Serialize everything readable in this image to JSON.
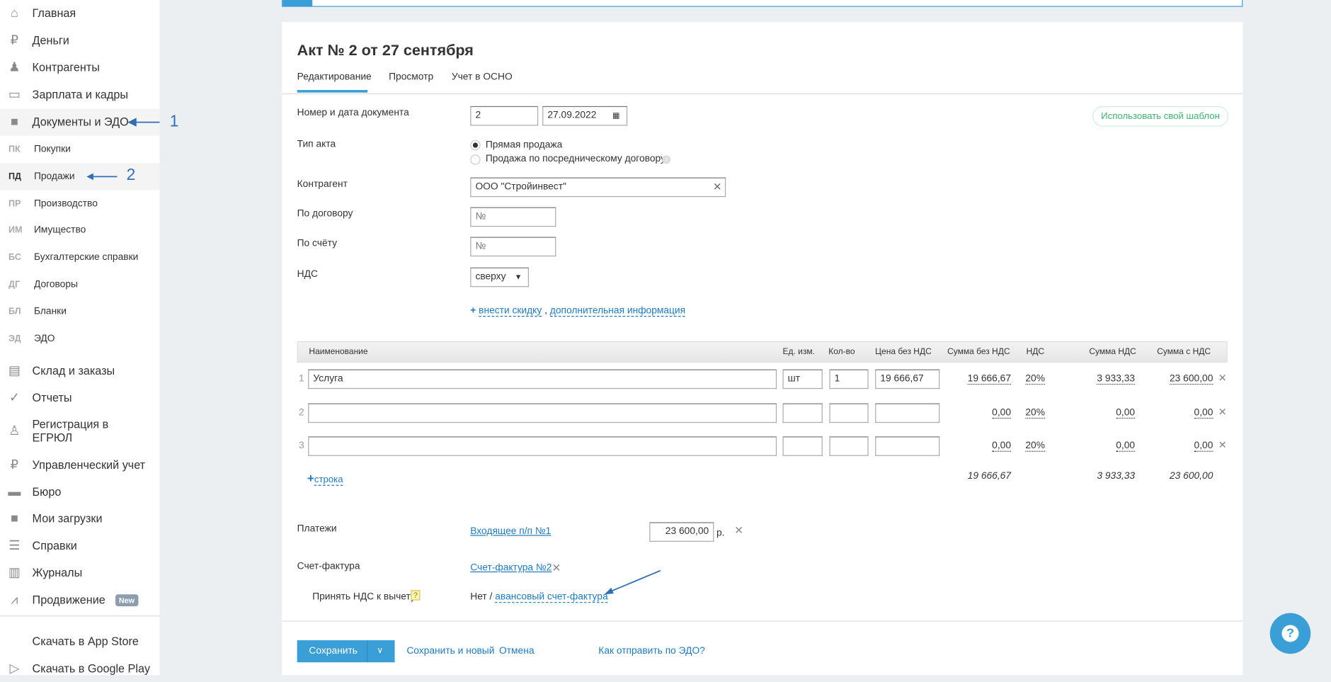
{
  "sidebar": {
    "items": [
      {
        "label": "Главная",
        "icon": "home-icon",
        "glyph": "⌂"
      },
      {
        "label": "Деньги",
        "icon": "money-icon",
        "glyph": "₽"
      },
      {
        "label": "Контрагенты",
        "icon": "contractors-icon",
        "glyph": "♟"
      },
      {
        "label": "Зарплата и кадры",
        "icon": "wallet-icon",
        "glyph": "▭"
      },
      {
        "label": "Документы и ЭДО",
        "icon": "folder-icon",
        "glyph": "■",
        "active": true
      }
    ],
    "subitems": [
      {
        "abbr": "ПК",
        "label": "Покупки"
      },
      {
        "abbr": "ПД",
        "label": "Продажи",
        "active": true
      },
      {
        "abbr": "ПР",
        "label": "Производство"
      },
      {
        "abbr": "ИМ",
        "label": "Имущество"
      },
      {
        "abbr": "БС",
        "label": "Бухгалтерские справки"
      },
      {
        "abbr": "ДГ",
        "label": "Договоры"
      },
      {
        "abbr": "БЛ",
        "label": "Бланки"
      },
      {
        "abbr": "ЭД",
        "label": "ЭДО"
      }
    ],
    "items2": [
      {
        "label": "Склад и заказы",
        "icon": "warehouse-icon",
        "glyph": "▤"
      },
      {
        "label": "Отчеты",
        "icon": "reports-icon",
        "glyph": "✓"
      },
      {
        "label": "Регистрация в ЕГРЮЛ",
        "icon": "registration-icon",
        "glyph": "♙"
      },
      {
        "label": "Управленческий учет",
        "icon": "management-icon",
        "glyph": "₽"
      },
      {
        "label": "Бюро",
        "icon": "briefcase-icon",
        "glyph": "▬"
      },
      {
        "label": "Мои загрузки",
        "icon": "folder-icon",
        "glyph": "■"
      },
      {
        "label": "Справки",
        "icon": "info-list-icon",
        "glyph": "☰"
      },
      {
        "label": "Журналы",
        "icon": "journal-icon",
        "glyph": "▥"
      },
      {
        "label": "Продвижение",
        "icon": "chart-icon",
        "glyph": "⩘",
        "badge": "New"
      }
    ],
    "downloads": [
      {
        "label": "Скачать в App Store",
        "icon": "apple-icon",
        "glyph": ""
      },
      {
        "label": "Скачать в Google Play",
        "icon": "google-play-icon",
        "glyph": "▷"
      }
    ]
  },
  "annotations": {
    "arrow1": "1",
    "arrow2": "2"
  },
  "doc": {
    "title": "Акт № 2 от 27 сентября",
    "tabs": [
      "Редактирование",
      "Просмотр",
      "Учет в ОСНО"
    ],
    "template_button": "Использовать свой шаблон",
    "number_label": "Номер и дата документа",
    "number": "2",
    "date": "27.09.2022",
    "type_label": "Тип акта",
    "type_options": [
      "Прямая продажа",
      "Продажа по посредническому договору"
    ],
    "contractor_label": "Контрагент",
    "contractor": "ООО \"Стройинвест\"",
    "contract_label": "По договору",
    "contract_placeholder": "№",
    "invoice_label": "По счёту",
    "invoice_placeholder": "№",
    "vat_label": "НДС",
    "vat_mode": "сверху",
    "discount_link": "внести скидку",
    "extra_link": "дополнительная информация",
    "comma": ","
  },
  "table": {
    "headers": [
      "Наименование",
      "Ед. изм.",
      "Кол-во",
      "Цена без НДС",
      "Сумма без НДС",
      "НДС",
      "Сумма НДС",
      "Сумма с НДС"
    ],
    "rows": [
      {
        "n": "1",
        "name": "Услуга",
        "unit": "шт",
        "qty": "1",
        "price": "19 666,67",
        "sum": "19 666,67",
        "vat": "20%",
        "vat_sum": "3 933,33",
        "total": "23 600,00"
      },
      {
        "n": "2",
        "name": "",
        "unit": "",
        "qty": "",
        "price": "",
        "sum": "0,00",
        "vat": "20%",
        "vat_sum": "0,00",
        "total": "0,00"
      },
      {
        "n": "3",
        "name": "",
        "unit": "",
        "qty": "",
        "price": "",
        "sum": "0,00",
        "vat": "20%",
        "vat_sum": "0,00",
        "total": "0,00"
      }
    ],
    "add_row": "строка",
    "totals": {
      "sum": "19 666,67",
      "vat_sum": "3 933,33",
      "total": "23 600,00"
    }
  },
  "payments": {
    "label": "Платежи",
    "link": "Входящее п/п №1",
    "amount": "23 600,00",
    "currency": "р."
  },
  "invoice": {
    "label": "Счет-фактура",
    "link": "Счет-фактура №2",
    "deduct_label": "Принять НДС к вычету",
    "deduct_value": "Нет /",
    "advance_link": "авансовый счет-фактура",
    "hint": "?"
  },
  "footer": {
    "save": "Сохранить",
    "save_new": "Сохранить и новый",
    "cancel": "Отмена",
    "edo_help": "Как отправить по ЭДО?"
  },
  "help": "?"
}
